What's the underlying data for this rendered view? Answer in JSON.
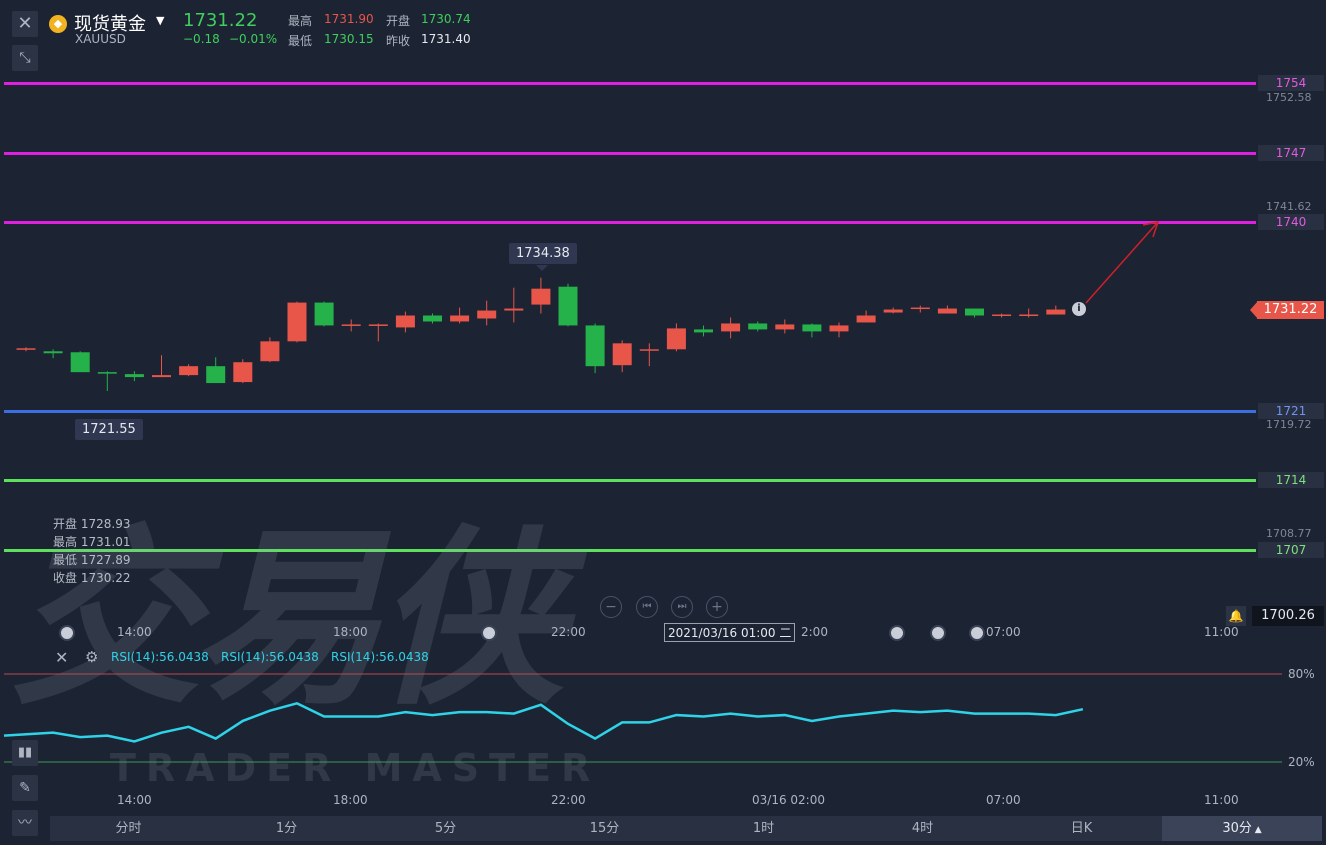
{
  "header": {
    "name": "现货黄金",
    "symbol": "XAUUSD",
    "price": "1731.22",
    "change": "−0.18",
    "change_pct": "−0.01%",
    "high_label": "最高",
    "high_value": "1731.90",
    "open_label": "开盘",
    "open_value": "1730.74",
    "low_label": "最低",
    "low_value": "1730.15",
    "prev_label": "昨收",
    "prev_value": "1731.40"
  },
  "levels": [
    {
      "value": "1754",
      "color": "#e020e0",
      "label_color": "#e05be0"
    },
    {
      "value": "1747",
      "color": "#e020e0",
      "label_color": "#e05be0"
    },
    {
      "value": "1740",
      "color": "#e020e0",
      "label_color": "#e05be0"
    },
    {
      "value": "1721",
      "color": "#3b6fe0",
      "label_color": "#6f95f0"
    },
    {
      "value": "1714",
      "color": "#5ee05e",
      "label_color": "#7fe07f"
    },
    {
      "value": "1707",
      "color": "#5ee05e",
      "label_color": "#7fe07f"
    }
  ],
  "scale_labels": [
    "1752.58",
    "1741.62",
    "1719.72",
    "1708.77"
  ],
  "current_price_tag": "1731.22",
  "bottom_price_tag": "1700.26",
  "tooltips": {
    "high": "1734.38",
    "low": "1721.55",
    "crosshair_time": "2021/03/16 01:00 二"
  },
  "ohlc": {
    "open_label": "开盘",
    "open_value": "1728.93",
    "high_label": "最高",
    "high_value": "1731.01",
    "low_label": "最低",
    "low_value": "1727.89",
    "close_label": "收盘",
    "close_value": "1730.22"
  },
  "rsi_labels": [
    "RSI(14):56.0438",
    "RSI(14):56.0438",
    "RSI(14):56.0438"
  ],
  "rsi_levels": {
    "upper": "80%",
    "lower": "20%"
  },
  "x_labels_main": [
    "14:00",
    "18:00",
    "22:00",
    "2:00",
    "07:00",
    "11:00"
  ],
  "x_labels_bottom": [
    "14:00",
    "18:00",
    "22:00",
    "03/16 02:00",
    "07:00",
    "11:00"
  ],
  "tabs": [
    "分时",
    "1分",
    "5分",
    "15分",
    "1时",
    "4时",
    "日K",
    "30分"
  ],
  "active_tab": "30分",
  "watermark": {
    "cn": "交易侠",
    "en": "TRADER MASTER"
  },
  "colors": {
    "up": "#e8564a",
    "down": "#25b24a",
    "rsi": "#2fd3e8"
  },
  "chart_data": {
    "type": "candlestick",
    "candles": [
      {
        "o": 1727.2,
        "h": 1727.4,
        "l": 1727.0,
        "c": 1727.3
      },
      {
        "o": 1727.0,
        "h": 1727.2,
        "l": 1726.3,
        "c": 1726.8
      },
      {
        "o": 1726.9,
        "h": 1727.0,
        "l": 1724.9,
        "c": 1724.9
      },
      {
        "o": 1724.9,
        "h": 1725.0,
        "l": 1723.0,
        "c": 1724.8
      },
      {
        "o": 1724.7,
        "h": 1725.0,
        "l": 1724.0,
        "c": 1724.4
      },
      {
        "o": 1724.4,
        "h": 1726.6,
        "l": 1724.4,
        "c": 1724.6
      },
      {
        "o": 1724.6,
        "h": 1725.7,
        "l": 1724.5,
        "c": 1725.5
      },
      {
        "o": 1725.5,
        "h": 1726.4,
        "l": 1723.8,
        "c": 1723.8
      },
      {
        "o": 1723.9,
        "h": 1726.2,
        "l": 1723.8,
        "c": 1725.9
      },
      {
        "o": 1726.0,
        "h": 1728.4,
        "l": 1725.9,
        "c": 1728.0
      },
      {
        "o": 1728.0,
        "h": 1732.0,
        "l": 1727.9,
        "c": 1731.9
      },
      {
        "o": 1731.9,
        "h": 1732.0,
        "l": 1729.5,
        "c": 1729.6
      },
      {
        "o": 1729.6,
        "h": 1730.2,
        "l": 1729.0,
        "c": 1729.7
      },
      {
        "o": 1729.6,
        "h": 1729.8,
        "l": 1728.0,
        "c": 1729.7
      },
      {
        "o": 1729.4,
        "h": 1731.0,
        "l": 1728.9,
        "c": 1730.6
      },
      {
        "o": 1730.6,
        "h": 1730.8,
        "l": 1729.8,
        "c": 1730.0
      },
      {
        "o": 1730.0,
        "h": 1731.4,
        "l": 1729.8,
        "c": 1730.6
      },
      {
        "o": 1730.3,
        "h": 1732.1,
        "l": 1729.6,
        "c": 1731.1
      },
      {
        "o": 1731.1,
        "h": 1733.4,
        "l": 1729.9,
        "c": 1731.3
      },
      {
        "o": 1731.7,
        "h": 1734.4,
        "l": 1730.8,
        "c": 1733.3
      },
      {
        "o": 1733.5,
        "h": 1733.8,
        "l": 1729.5,
        "c": 1729.6
      },
      {
        "o": 1729.6,
        "h": 1729.8,
        "l": 1724.8,
        "c": 1725.5
      },
      {
        "o": 1725.6,
        "h": 1728.1,
        "l": 1724.9,
        "c": 1727.8
      },
      {
        "o": 1727.2,
        "h": 1727.8,
        "l": 1725.5,
        "c": 1727.2
      },
      {
        "o": 1727.2,
        "h": 1729.8,
        "l": 1727.0,
        "c": 1729.3
      },
      {
        "o": 1729.2,
        "h": 1729.6,
        "l": 1728.5,
        "c": 1728.9
      },
      {
        "o": 1729.0,
        "h": 1730.4,
        "l": 1728.3,
        "c": 1729.8
      },
      {
        "o": 1729.8,
        "h": 1730.0,
        "l": 1729.0,
        "c": 1729.2
      },
      {
        "o": 1729.2,
        "h": 1730.2,
        "l": 1728.8,
        "c": 1729.7
      },
      {
        "o": 1729.7,
        "h": 1729.8,
        "l": 1728.4,
        "c": 1729.0
      },
      {
        "o": 1729.0,
        "h": 1729.9,
        "l": 1728.4,
        "c": 1729.6
      },
      {
        "o": 1729.9,
        "h": 1731.1,
        "l": 1729.9,
        "c": 1730.6
      },
      {
        "o": 1730.9,
        "h": 1731.4,
        "l": 1730.8,
        "c": 1731.2
      },
      {
        "o": 1731.4,
        "h": 1731.6,
        "l": 1730.9,
        "c": 1731.4
      },
      {
        "o": 1730.8,
        "h": 1731.6,
        "l": 1730.8,
        "c": 1731.3
      },
      {
        "o": 1731.3,
        "h": 1731.3,
        "l": 1730.4,
        "c": 1730.6
      },
      {
        "o": 1730.6,
        "h": 1730.8,
        "l": 1730.4,
        "c": 1730.7
      },
      {
        "o": 1730.7,
        "h": 1731.3,
        "l": 1730.4,
        "c": 1730.7
      },
      {
        "o": 1730.7,
        "h": 1731.6,
        "l": 1730.7,
        "c": 1731.2
      }
    ],
    "rsi": [
      38,
      40,
      37,
      38,
      34,
      40,
      44,
      36,
      48,
      55,
      60,
      51,
      51,
      51,
      54,
      52,
      54,
      54,
      53,
      59,
      46,
      36,
      47,
      47,
      52,
      51,
      53,
      51,
      52,
      48,
      51,
      53,
      55,
      54,
      55,
      53,
      53,
      53,
      52,
      56
    ],
    "rsi_upper": 80,
    "rsi_lower": 20
  }
}
